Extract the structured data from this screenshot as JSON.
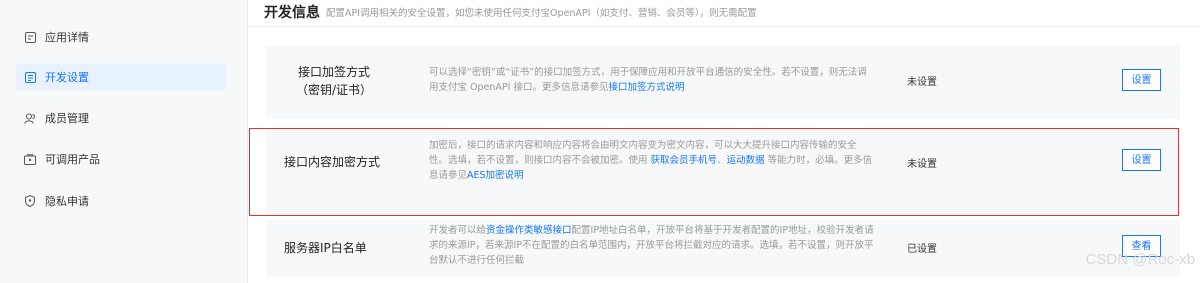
{
  "sidebar": {
    "items": [
      {
        "label": "应用详情",
        "icon": "app-detail-icon"
      },
      {
        "label": "开发设置",
        "icon": "dev-settings-icon",
        "active": true
      },
      {
        "label": "成员管理",
        "icon": "member-icon"
      },
      {
        "label": "可调用产品",
        "icon": "product-icon"
      },
      {
        "label": "隐私申请",
        "icon": "privacy-icon"
      }
    ]
  },
  "header": {
    "title": "开发信息",
    "subtitle": "配置API调用相关的安全设置，如您未使用任何支付宝OpenAPI（如支付、营销、会员等），则无需配置"
  },
  "rows": [
    {
      "name_line1": "接口加签方式",
      "name_line2": "（密钥/证书）",
      "desc_text": "可以选择“密钥”或“证书”的接口加签方式，用于保障应用和开放平台通信的安全性。若不设置，则无法调用支付宝 OpenAPI 接口。更多信息请参见",
      "desc_link": "接口加签方式说明",
      "status": "未设置",
      "button": "设置"
    },
    {
      "name_line1": "接口内容加密方式",
      "desc_text1": "加密后，接口的请求内容和响应内容将会由明文内容变为密文内容，可以大大提升接口内容传输的安全性。选填，若不设置，则接口内容不会被加密。使用 ",
      "desc_link1": "获取会员手机号",
      "desc_sep": "、",
      "desc_link2": "运动数据",
      "desc_text2": " 等能力时，必填。更多信息请参见",
      "desc_link3": "AES加密说明",
      "status": "未设置",
      "button": "设置"
    },
    {
      "name_line1": "服务器IP白名单",
      "desc_text1": "开发者可以给",
      "desc_link1": "资金操作类敏感接口",
      "desc_text2": "配置IP地址白名单，开放平台将基于开发者配置的IP地址，校验开发者请求的来源IP，若来源IP不在配置的白名单范围内，开放平台将拦截对应的请求。选填，若不设置，则开放平台默认不进行任何拦截",
      "status": "已设置",
      "button": "查看"
    }
  ],
  "watermark": "CSDN @Roc-xb",
  "colors": {
    "accent": "#1677ff",
    "highlight": "#e5312f",
    "card_bg": "#f7f8fa"
  }
}
